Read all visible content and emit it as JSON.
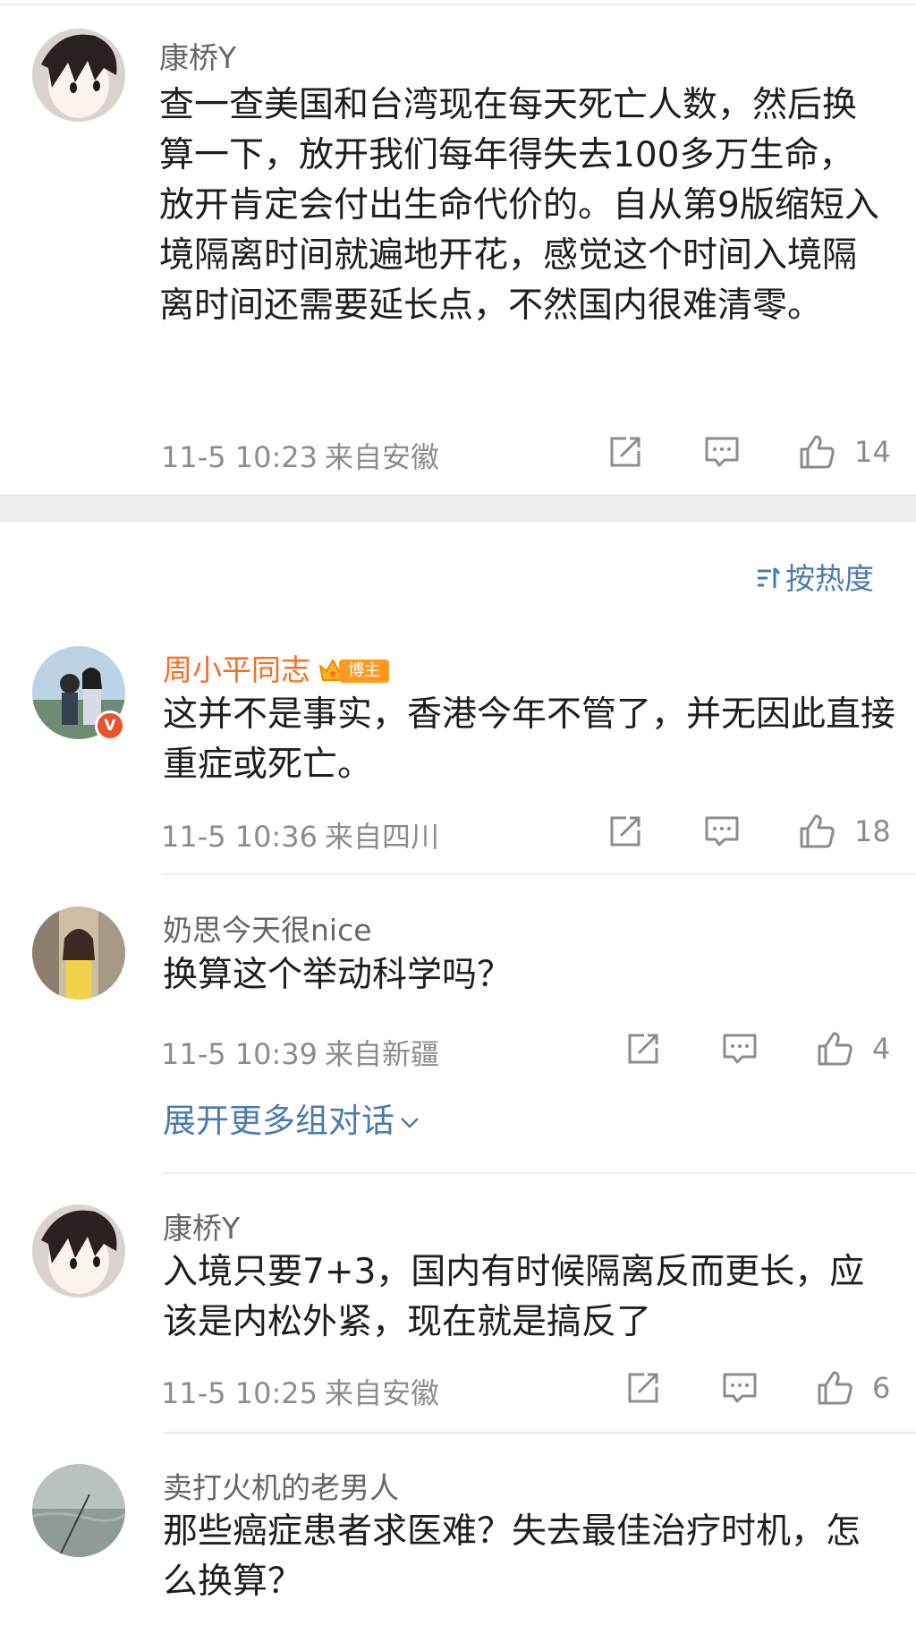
{
  "comments": [
    {
      "name": "康桥Y",
      "text": "查一查美国和台湾现在每天死亡人数，然后换算一下，放开我们每年得失去100多万生命，放开肯定会付出生命代价的。自从第9版缩短入境隔离时间就遍地开花，感觉这个时间入境隔离时间还需要延长点，不然国内很难清零。",
      "time": "11-5 10:23",
      "location": "来自安徽",
      "likes": "14"
    },
    {
      "name": "周小平同志",
      "badge": "博主",
      "verified_mark": "V",
      "text": "这并不是事实，香港今年不管了，并无因此直接重症或死亡。",
      "time": "11-5 10:36",
      "location": "来自四川",
      "likes": "18"
    },
    {
      "name": "奶思今天很nice",
      "text": "换算这个举动科学吗？",
      "time": "11-5 10:39",
      "location": "来自新疆",
      "likes": "4"
    },
    {
      "name": "康桥Y",
      "text": "入境只要7+3，国内有时候隔离反而更长，应该是内松外紧，现在就是搞反了",
      "time": "11-5 10:25",
      "location": "来自安徽",
      "likes": "6"
    },
    {
      "name": "卖打火机的老男人",
      "text": "那些癌症患者求医难？失去最佳治疗时机，怎么换算？"
    }
  ],
  "sort_label": "按热度",
  "expand_label": "展开更多组对话",
  "icons": {
    "share": "share-icon",
    "comment": "comment-icon",
    "like": "like-icon",
    "sort": "sort-icon",
    "expand": "chevron-down-icon"
  },
  "colors": {
    "link_blue": "#4a7bb0",
    "vip_orange": "#f86e20",
    "meta_gray": "#8c8c8c"
  }
}
